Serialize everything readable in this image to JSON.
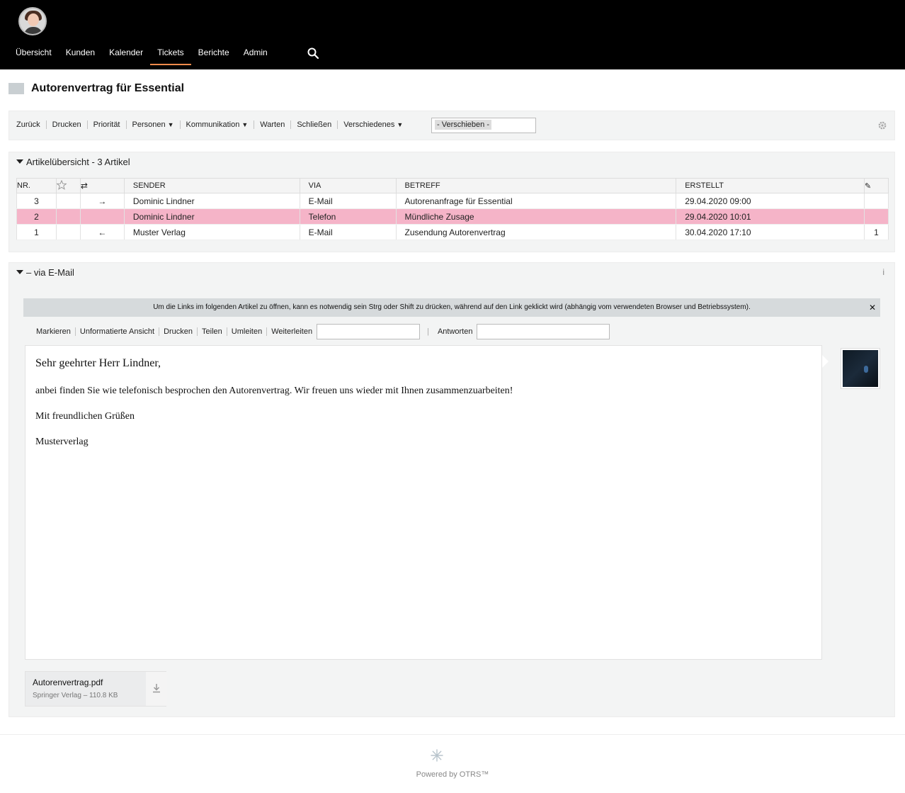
{
  "nav": {
    "items": [
      "Übersicht",
      "Kunden",
      "Kalender",
      "Tickets",
      "Berichte",
      "Admin"
    ],
    "active": "Tickets"
  },
  "ticket": {
    "title": "Autorenvertrag für Essential"
  },
  "toolbar": {
    "items": [
      {
        "label": "Zurück",
        "dropdown": false
      },
      {
        "label": "Drucken",
        "dropdown": false
      },
      {
        "label": "Priorität",
        "dropdown": false
      },
      {
        "label": "Personen",
        "dropdown": true
      },
      {
        "label": "Kommunikation",
        "dropdown": true
      },
      {
        "label": "Warten",
        "dropdown": false
      },
      {
        "label": "Schließen",
        "dropdown": false
      },
      {
        "label": "Verschiedenes",
        "dropdown": true
      }
    ],
    "move_select": "- Verschieben -"
  },
  "overview": {
    "heading": "Artikelübersicht - 3 Artikel",
    "columns": [
      "NR.",
      "SENDER",
      "VIA",
      "BETREFF",
      "ERSTELLT"
    ],
    "rows": [
      {
        "nr": "3",
        "direction": "→",
        "sender": "Dominic Lindner",
        "via": "E-Mail",
        "subject": "Autorenanfrage für Essential",
        "created": "29.04.2020 09:00",
        "attachments": "",
        "highlight": false
      },
      {
        "nr": "2",
        "direction": "",
        "sender": "Dominic Lindner",
        "via": "Telefon",
        "subject": "Mündliche Zusage",
        "created": "29.04.2020 10:01",
        "attachments": "",
        "highlight": true
      },
      {
        "nr": "1",
        "direction": "←",
        "sender": "Muster Verlag",
        "via": "E-Mail",
        "subject": "Zusendung Autorenvertrag",
        "created": "30.04.2020 17:10",
        "attachments": "1",
        "highlight": false
      }
    ]
  },
  "article": {
    "heading": "– via E-Mail",
    "notice": "Um die Links im folgenden Artikel zu öffnen, kann es notwendig sein Strg oder Shift zu drücken, während auf den Link geklickt wird (abhängig vom verwendeten Browser und Betriebssystem).",
    "actions": [
      "Markieren",
      "Unformatierte Ansicht",
      "Drucken",
      "Teilen",
      "Umleiten",
      "Weiterleiten"
    ],
    "reply_label": "Antworten",
    "body": {
      "greeting": "Sehr geehrter Herr Lindner,",
      "line1": "anbei finden Sie wie telefonisch besprochen den Autorenvertrag. Wir freuen uns wieder mit Ihnen zusammenzuarbeiten!",
      "closing": "Mit freundlichen Grüßen",
      "signature": "Musterverlag"
    },
    "attachment": {
      "name": "Autorenvertrag.pdf",
      "meta": "Springer Verlag – 110.8 KB"
    }
  },
  "footer": {
    "powered": "Powered by OTRS™"
  },
  "colors": {
    "accent": "#f08a4b",
    "highlight_row": "#f5b4c8"
  }
}
